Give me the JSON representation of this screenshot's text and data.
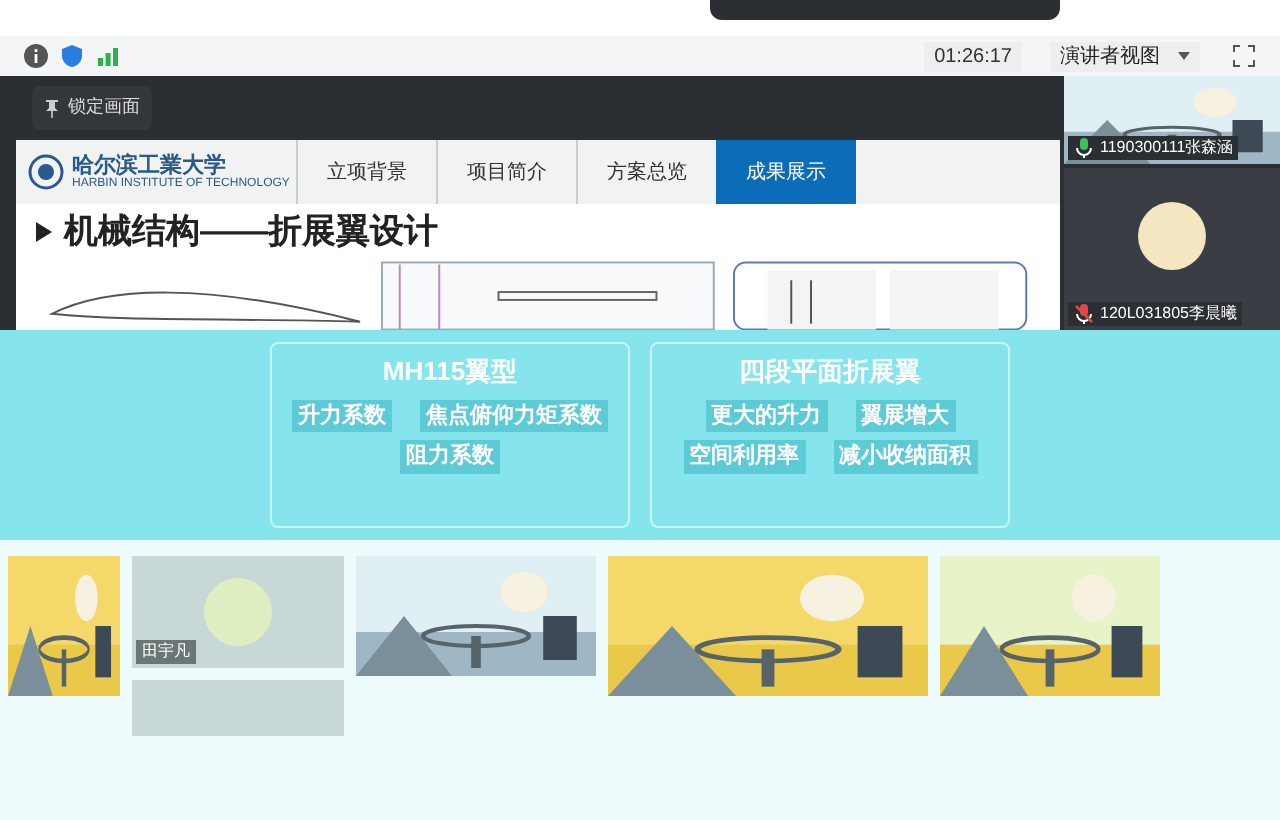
{
  "toolbar": {
    "timer": "01:26:17",
    "view_button": "演讲者视图"
  },
  "pin_button": "锁定画面",
  "slide": {
    "logo": {
      "name": "哈尔滨工業大学",
      "subtitle": "HARBIN INSTITUTE OF TECHNOLOGY"
    },
    "tabs": [
      {
        "label": "立项背景",
        "selected": false
      },
      {
        "label": "项目简介",
        "selected": false
      },
      {
        "label": "方案总览",
        "selected": false
      },
      {
        "label": "成果展示",
        "selected": true
      }
    ],
    "title": "机械结构——折展翼设计",
    "panels": [
      {
        "heading": "MH115翼型",
        "lines": [
          "升力系数",
          "焦点俯仰力矩系数",
          "阻力系数"
        ]
      },
      {
        "heading": "四段平面折展翼",
        "lines": [
          "更大的升力",
          "翼展增大",
          "空间利用率",
          "减小收纳面积"
        ]
      }
    ]
  },
  "participants": [
    {
      "name": "1190300111张森涵",
      "kind": "video",
      "muted": false
    },
    {
      "name": "120L031805李晨曦",
      "kind": "avatar",
      "muted": true
    }
  ],
  "gallery": [
    {
      "name": "田宇凡"
    }
  ]
}
